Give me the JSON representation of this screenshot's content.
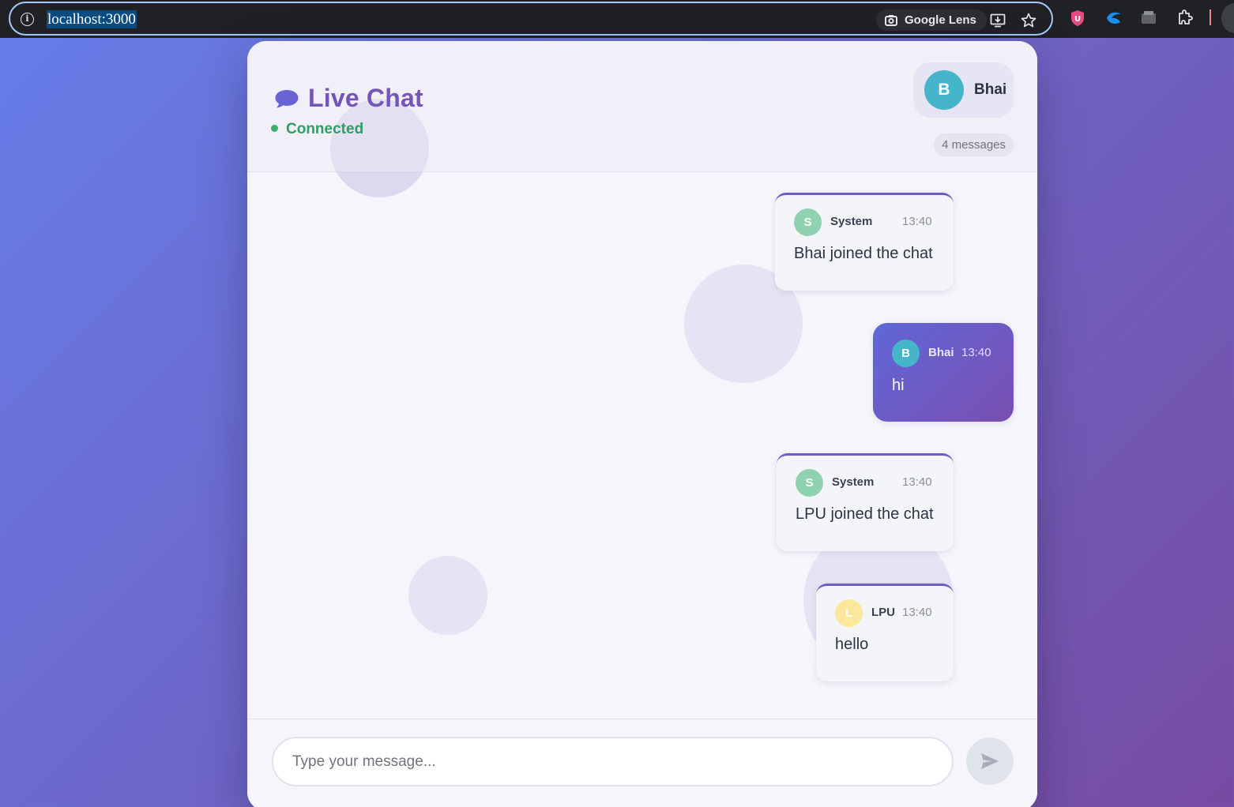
{
  "browser": {
    "url": "localhost:3000",
    "lens_label": "Google Lens"
  },
  "header": {
    "title": "Live Chat",
    "status": "Connected",
    "user": {
      "initial": "B",
      "name": "Bhai",
      "avatar_color": "#45b5c9"
    },
    "message_count": "4 messages"
  },
  "messages": [
    {
      "initial": "S",
      "sender": "System",
      "time": "13:40",
      "text": "Bhai joined the chat",
      "avatar_color": "#8fd1b0"
    },
    {
      "initial": "B",
      "sender": "Bhai",
      "time": "13:40",
      "text": "hi",
      "avatar_color": "#45b5c9",
      "own": true
    },
    {
      "initial": "S",
      "sender": "System",
      "time": "13:40",
      "text": "LPU joined the chat",
      "avatar_color": "#8fd1b0"
    },
    {
      "initial": "L",
      "sender": "LPU",
      "time": "13:40",
      "text": "hello",
      "avatar_color": "#fde79a"
    }
  ],
  "composer": {
    "placeholder": "Type your message...",
    "value": ""
  },
  "colors": {
    "accent": "#7555b8",
    "connected": "#2f9e64",
    "gradient_start": "#667eea",
    "gradient_end": "#764ba2"
  }
}
